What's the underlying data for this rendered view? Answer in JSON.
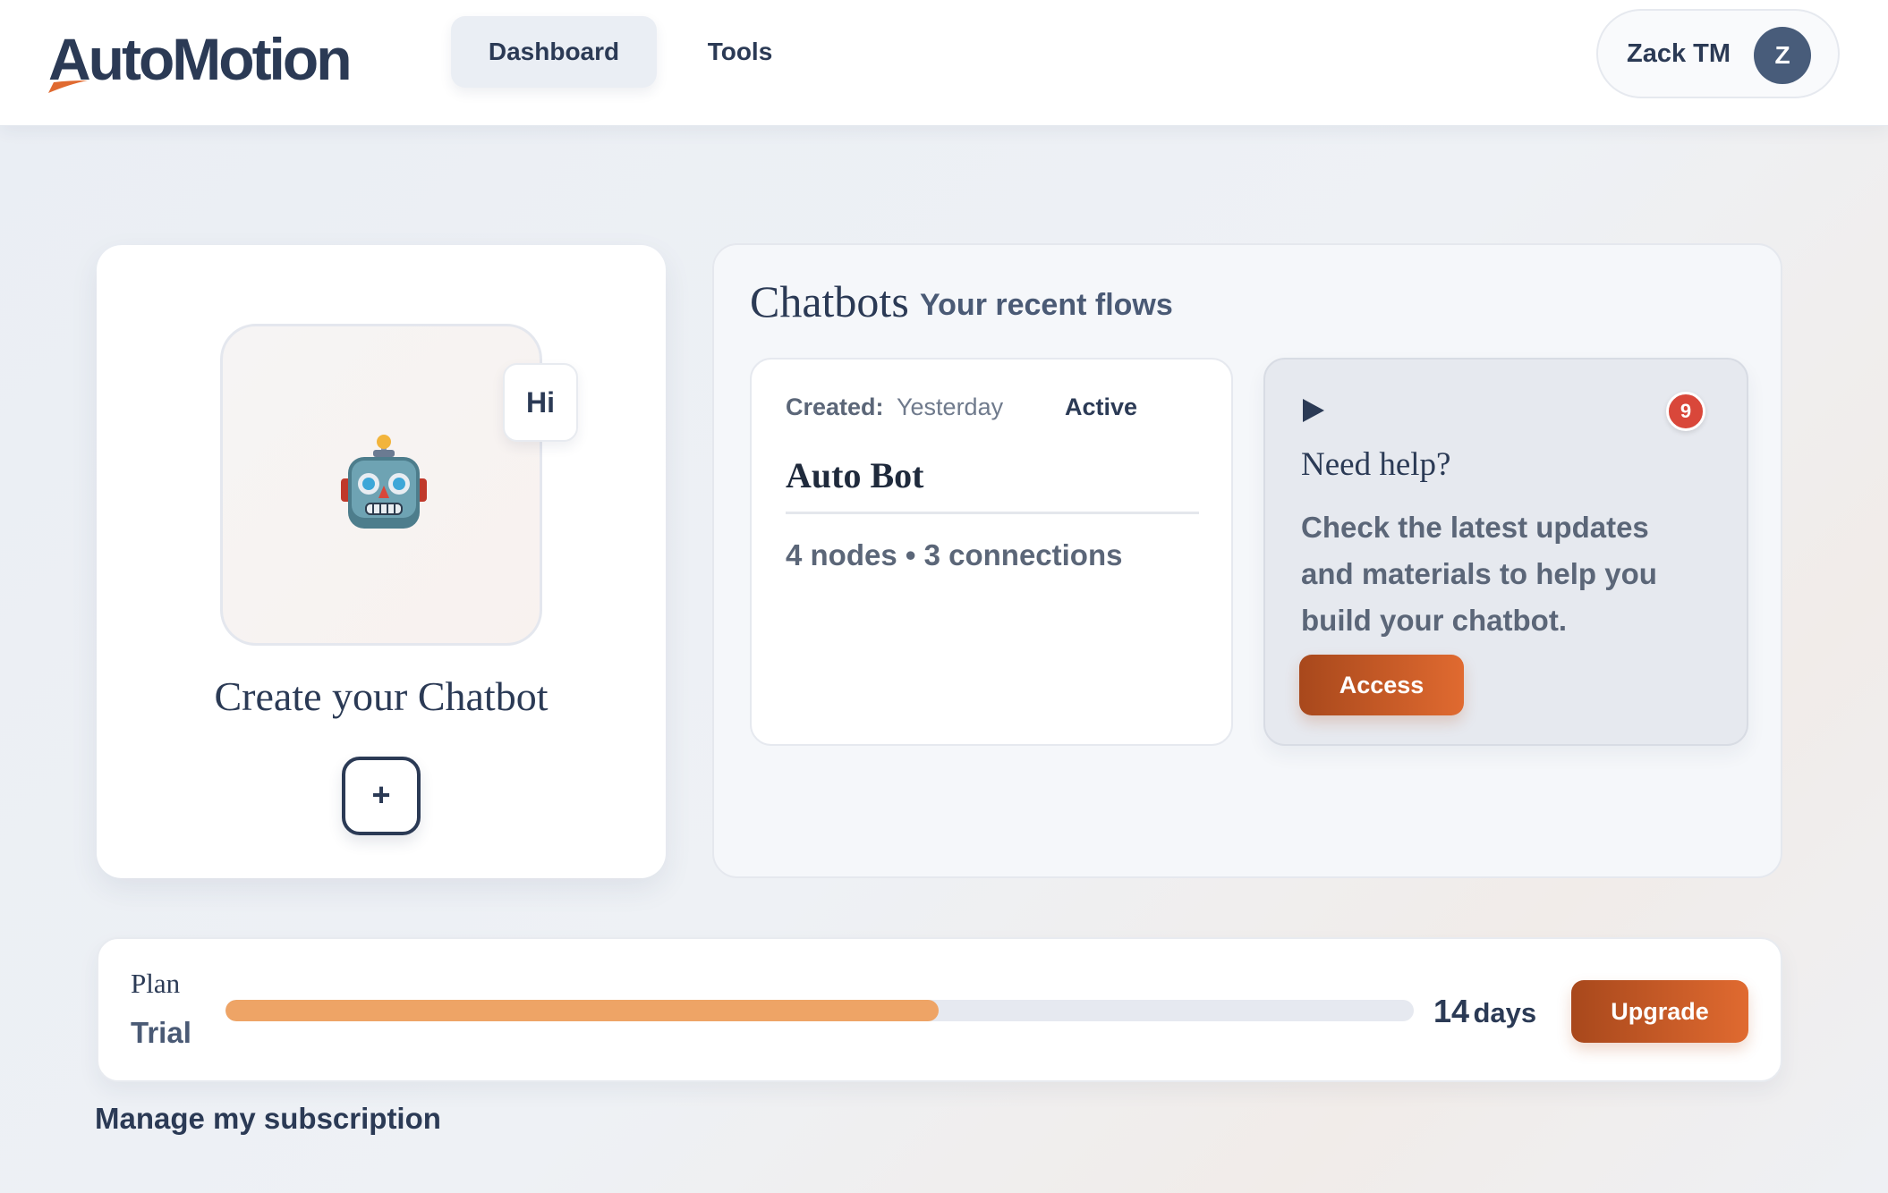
{
  "header": {
    "logo_text": "AutoMotion",
    "nav": [
      {
        "label": "Dashboard",
        "active": true
      },
      {
        "label": "Tools",
        "active": false
      }
    ],
    "user": {
      "name": "Zack TM",
      "avatar_initial": "Z"
    }
  },
  "create_card": {
    "icon": "robot-icon",
    "speech_bubble": "Hi",
    "title": "Create your Chatbot",
    "add_button_label": "+"
  },
  "chatbots": {
    "title": "Chatbots",
    "subtitle": "Your recent flows",
    "flows": [
      {
        "created_label": "Created:",
        "created_value": "Yesterday",
        "status": "Active",
        "name": "Auto Bot",
        "meta": "4 nodes • 3 connections"
      }
    ],
    "help": {
      "icon": "play-icon",
      "badge_count": "9",
      "title": "Need help?",
      "text": "Check the latest updates and materials to help you build your chatbot.",
      "button_label": "Access"
    }
  },
  "plan": {
    "label": "Plan",
    "name": "Trial",
    "progress_percent": 60,
    "days_number": "14",
    "days_unit": "days",
    "upgrade_label": "Upgrade"
  },
  "manage_link": "Manage my subscription",
  "colors": {
    "primary_text": "#2b3a55",
    "accent_orange": "#e06a30",
    "accent_orange_dark": "#a8481c",
    "progress_fill": "#eea466",
    "badge_red": "#d9473a",
    "avatar_bg": "#485c7a"
  }
}
